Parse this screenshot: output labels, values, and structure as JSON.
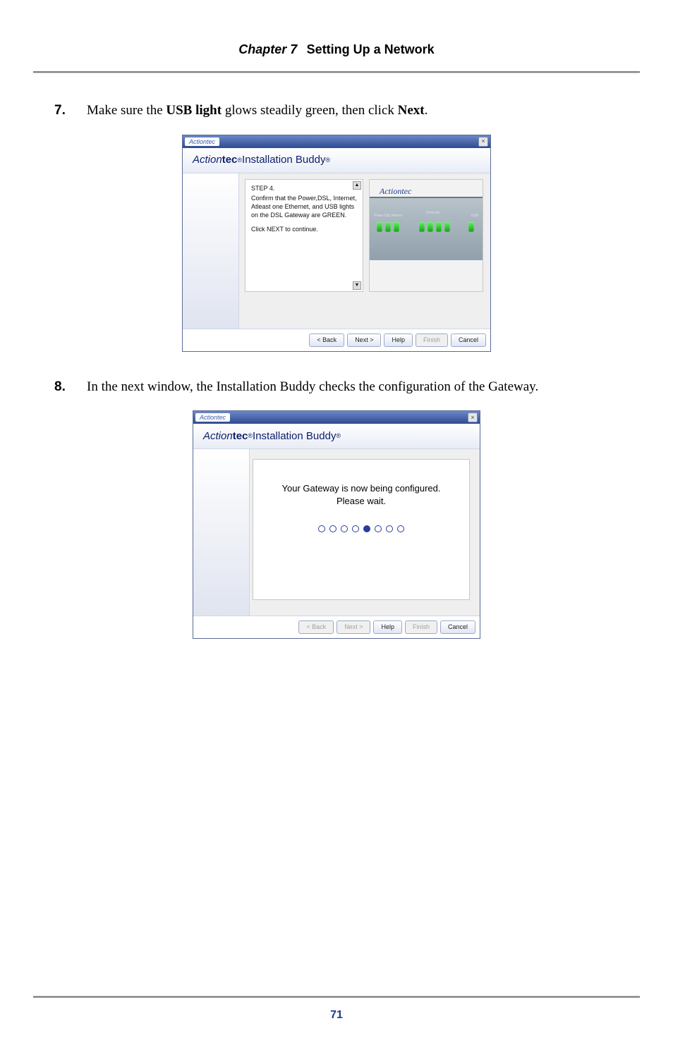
{
  "header": {
    "chapter_label": "Chapter 7",
    "chapter_title": "Setting Up a Network"
  },
  "steps": [
    {
      "number": "7.",
      "text_pre": "Make sure the ",
      "bold1": "USB light",
      "mid1": " glows steadily green, then click ",
      "bold2": "Next",
      "text_post": "."
    },
    {
      "number": "8.",
      "full": "In the next window, the Installation Buddy checks the configuration of the Gateway."
    }
  ],
  "window_common": {
    "title_chip": "Actiontec",
    "close_glyph": "×",
    "brand_prefix": "Action",
    "brand_bold": "tec",
    "reg": "®",
    "app_suffix": " Installation Buddy",
    "app_reg2": "®",
    "device_logo": "Actiontec"
  },
  "screenshot1": {
    "step_title": "STEP 4.",
    "step_body_a": "Confirm that the Power,DSL, Internet, Atleast one Ethernet, and USB lights on the DSL Gateway are GREEN.",
    "step_body_b": "Click NEXT to continue.",
    "light_labels": "Power DSL Internet",
    "eth_label": "Ethernet",
    "usb_label": "USB",
    "buttons": {
      "back": "< Back",
      "next": "Next >",
      "help": "Help",
      "finish": "Finish",
      "cancel": "Cancel"
    }
  },
  "screenshot2": {
    "msg_line1": "Your Gateway is now being configured.",
    "msg_line2": "Please wait.",
    "active_dot_index": 4,
    "dot_count": 8,
    "buttons": {
      "back": "< Back",
      "next": "Next >",
      "help": "Help",
      "finish": "Finish",
      "cancel": "Cancel"
    }
  },
  "footer": {
    "page_number": "71"
  }
}
